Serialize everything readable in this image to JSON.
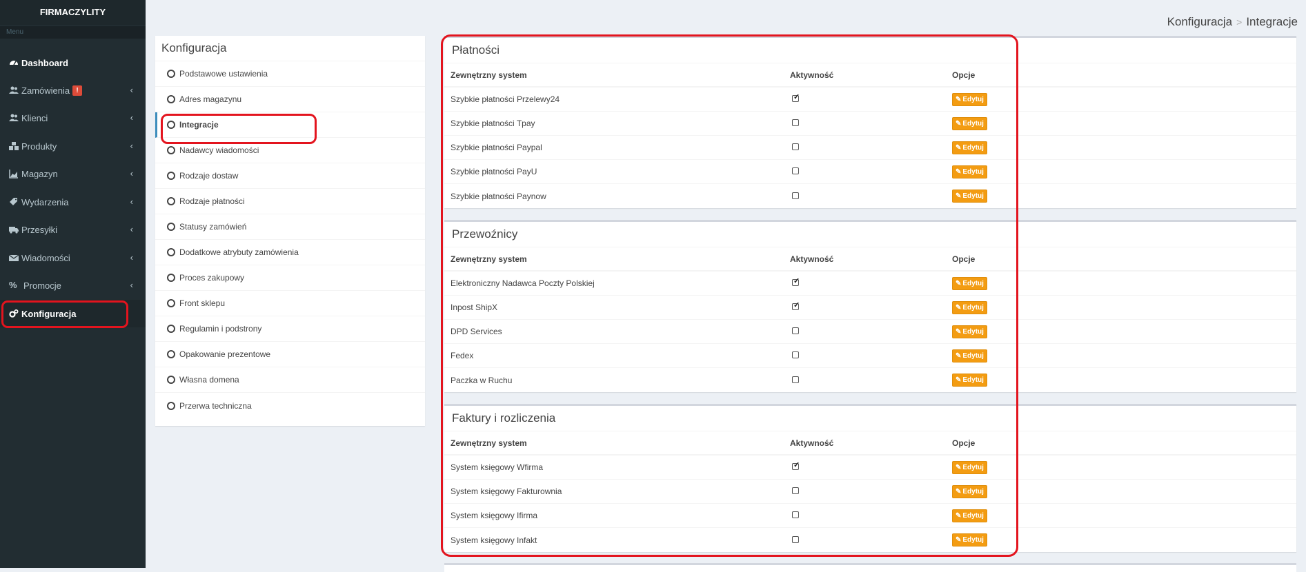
{
  "brand": "FIRMACZYLITY",
  "menu_header": "Menu",
  "sidebar": {
    "items": [
      {
        "label": "Dashboard",
        "icon": "dashboard-icon"
      },
      {
        "label": "Zamówienia",
        "icon": "users-icon",
        "badge": "!"
      },
      {
        "label": "Klienci",
        "icon": "users-icon"
      },
      {
        "label": "Produkty",
        "icon": "cubes-icon"
      },
      {
        "label": "Magazyn",
        "icon": "chart-area-icon"
      },
      {
        "label": "Wydarzenia",
        "icon": "tags-icon"
      },
      {
        "label": "Przesyłki",
        "icon": "truck-icon"
      },
      {
        "label": "Wiadomości",
        "icon": "envelope-icon"
      },
      {
        "label": "Promocje",
        "icon": "percent-icon"
      },
      {
        "label": "Konfiguracja",
        "icon": "gears-icon"
      }
    ]
  },
  "breadcrumb": {
    "parent": "Konfiguracja",
    "sep": ">",
    "current": "Integracje"
  },
  "config": {
    "title": "Konfiguracja",
    "items": [
      "Podstawowe ustawienia",
      "Adres magazynu",
      "Integracje",
      "Nadawcy wiadomości",
      "Rodzaje dostaw",
      "Rodzaje płatności",
      "Statusy zamówień",
      "Dodatkowe atrybuty zamówienia",
      "Proces zakupowy",
      "Front sklepu",
      "Regulamin i podstrony",
      "Opakowanie prezentowe",
      "Własna domena",
      "Przerwa techniczna"
    ]
  },
  "table_headers": {
    "system": "Zewnętrzny system",
    "activity": "Aktywność",
    "options": "Opcje"
  },
  "edit_label": "Edytuj",
  "sections": [
    {
      "title": "Płatności",
      "rows": [
        {
          "name": "Szybkie płatności Przelewy24",
          "active": true
        },
        {
          "name": "Szybkie płatności Tpay",
          "active": false
        },
        {
          "name": "Szybkie płatności Paypal",
          "active": false
        },
        {
          "name": "Szybkie płatności PayU",
          "active": false
        },
        {
          "name": "Szybkie płatności Paynow",
          "active": false
        }
      ]
    },
    {
      "title": "Przewoźnicy",
      "rows": [
        {
          "name": "Elektroniczny Nadawca Poczty Polskiej",
          "active": true
        },
        {
          "name": "Inpost ShipX",
          "active": true
        },
        {
          "name": "DPD Services",
          "active": false
        },
        {
          "name": "Fedex",
          "active": false
        },
        {
          "name": "Paczka w Ruchu",
          "active": false
        }
      ]
    },
    {
      "title": "Faktury i rozliczenia",
      "rows": [
        {
          "name": "System księgowy Wfirma",
          "active": true
        },
        {
          "name": "System księgowy Fakturownia",
          "active": false
        },
        {
          "name": "System księgowy Ifirma",
          "active": false
        },
        {
          "name": "System księgowy Infakt",
          "active": false
        }
      ]
    }
  ],
  "colors": {
    "sidebar": "#222d32",
    "edit_button": "#f39c12",
    "highlight": "#e3141e",
    "active_link": "#3c8dbc"
  }
}
